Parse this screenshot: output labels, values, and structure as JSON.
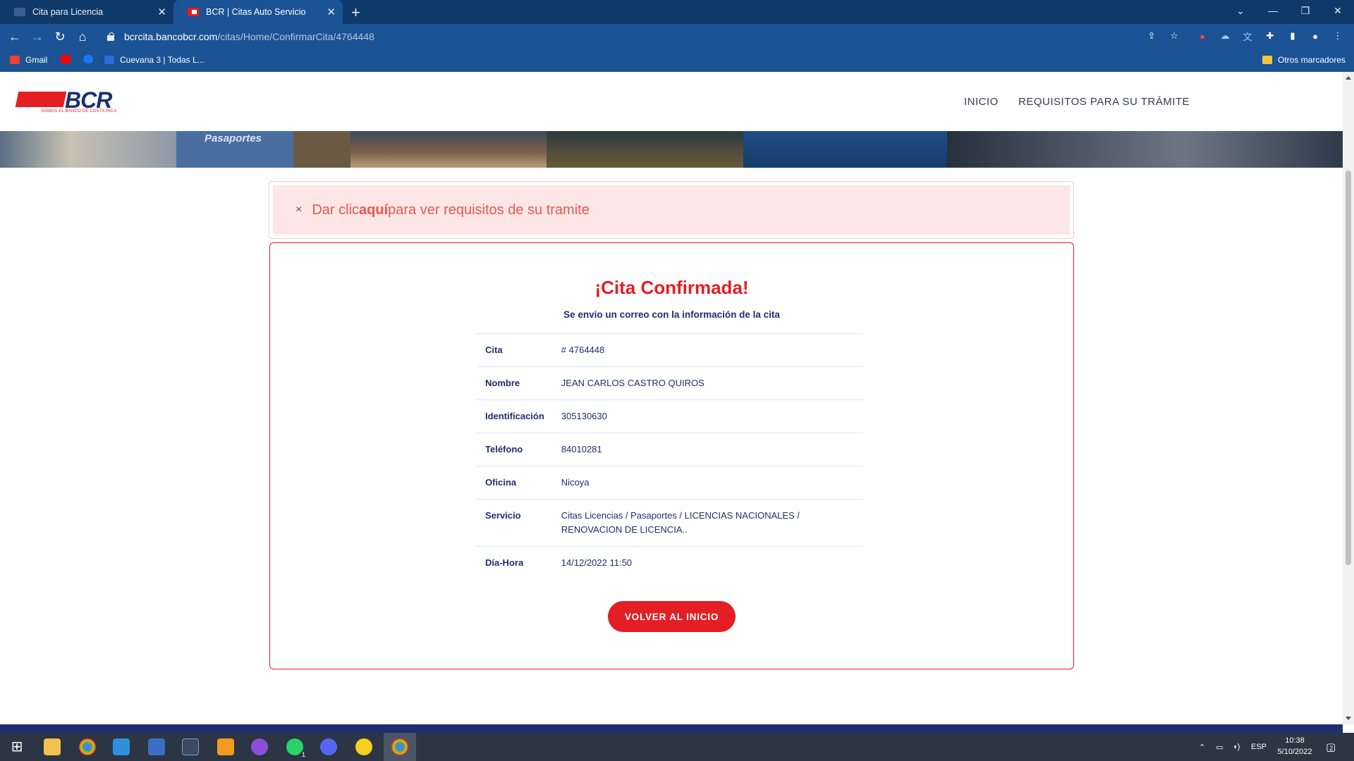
{
  "browser": {
    "tabs": [
      {
        "title": "Cita para Licencia",
        "active": false
      },
      {
        "title": "BCR | Citas Auto Servicio",
        "active": true
      }
    ],
    "url_host": "bcrcita.bancobcr.com",
    "url_path": "/citas/Home/ConfirmarCita/4764448",
    "bookmarks": [
      {
        "label": "Gmail",
        "icon": "gmail-icon",
        "color": "#ea4335"
      },
      {
        "label": "",
        "icon": "youtube-icon",
        "color": "#ff0000"
      },
      {
        "label": "",
        "icon": "facebook-icon",
        "color": "#1877f2"
      },
      {
        "label": "Cuevana 3 | Todas L...",
        "icon": "cuevana-icon",
        "color": "#2a6fd6"
      }
    ],
    "other_bookmarks": "Otros marcadores"
  },
  "site": {
    "logo_text": "BCR",
    "logo_tagline": "SOMOS EL BANCO DE COSTA RICA",
    "nav": [
      "INICIO",
      "REQUISITOS PARA SU TRÁMITE"
    ],
    "banner_text": "Pasaportes"
  },
  "alert": {
    "close": "×",
    "prefix": "Dar clic ",
    "link": "aquí",
    "suffix": " para ver requisitos de su tramite"
  },
  "confirmation": {
    "title": "¡Cita Confirmada!",
    "subtitle": "Se envio un correo con la información de la cita",
    "rows": [
      {
        "label": "Cita",
        "value": "# 4764448"
      },
      {
        "label": "Nombre",
        "value": "JEAN CARLOS CASTRO QUIROS"
      },
      {
        "label": "Identificación",
        "value": "305130630"
      },
      {
        "label": "Teléfono",
        "value": "84010281"
      },
      {
        "label": "Oficina",
        "value": "Nicoya"
      },
      {
        "label": "Servicio",
        "value": "Citas Licencias / Pasaportes / LICENCIAS NACIONALES / RENOVACION DE LICENCIA.."
      },
      {
        "label": "Día-Hora",
        "value": "14/12/2022 11:50"
      }
    ],
    "button": "VOLVER AL INICIO"
  },
  "taskbar": {
    "lang": "ESP",
    "time": "10:38",
    "date": "5/10/2022",
    "notifications": "2",
    "whatsapp_badge": "1"
  },
  "colors": {
    "brand_red": "#e31e24",
    "brand_navy": "#1d2f6f",
    "chrome_blue": "#1b5394",
    "alert_bg": "#fde6e6"
  }
}
